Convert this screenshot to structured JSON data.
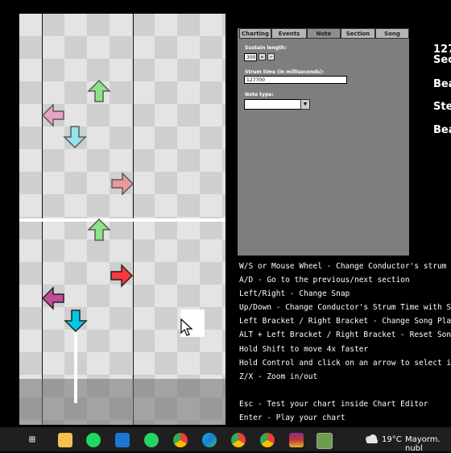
{
  "editor": {
    "tabs": [
      {
        "label": "Charting"
      },
      {
        "label": "Events"
      },
      {
        "label": "Note"
      },
      {
        "label": "Section"
      },
      {
        "label": "Song"
      }
    ],
    "note_panel": {
      "sustain_label": "Sustain length:",
      "sustain_value": "300",
      "plus": "+",
      "minus": "−",
      "strum_label": "Strum time (in milliseconds):",
      "strum_value": "127700",
      "notetype_label": "Note type:",
      "notetype_value": ""
    },
    "info": [
      "127",
      "Sec",
      "Bea",
      "Ste",
      "Bea"
    ],
    "help_lines": [
      "W/S or Mouse Wheel - Change Conductor's strum",
      "A/D - Go to the previous/next section",
      "Left/Right - Change Snap",
      "Up/Down - Change Conductor's Strum Time with S",
      "Left Bracket / Right Bracket - Change Song Pla",
      "ALT + Left Bracket / Right Bracket - Reset Son",
      "Hold Shift to move 4x faster",
      "Hold Control and click on an arrow to select i",
      "Z/X - Zoom in/out",
      "",
      "Esc - Test your chart inside Chart Editor",
      "Enter - Play your chart"
    ],
    "colors": {
      "left": "#c24b99",
      "down": "#00ffff",
      "up": "#12fa05",
      "right": "#f9393f",
      "panel": "#7e7e7e"
    }
  },
  "taskbar": {
    "icons": [
      "task-view-icon",
      "file-explorer-icon",
      "spotify-icon",
      "mail-icon",
      "whatsapp-icon",
      "chrome-icon",
      "edge-icon",
      "chrome-profile-icon",
      "chrome-profile2-icon",
      "winrar-icon",
      "game-icon"
    ],
    "weather": "19°C",
    "weather_text": "Mayorm. nubl"
  }
}
